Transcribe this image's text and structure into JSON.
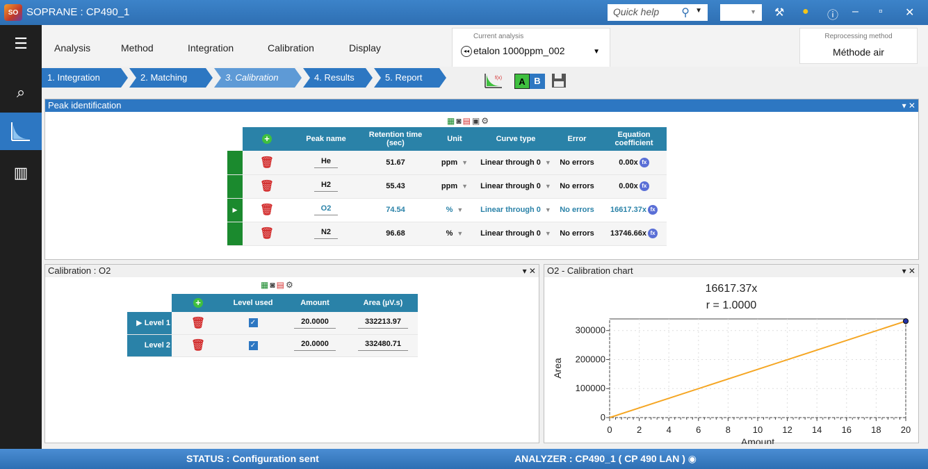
{
  "window": {
    "title": "SOPRANE : CP490_1",
    "logo_text": "SO",
    "quick_help_placeholder": "Quick help"
  },
  "menu": {
    "items": [
      "Analysis",
      "Method",
      "Integration",
      "Calibration",
      "Display"
    ]
  },
  "current_analysis": {
    "label": "Current analysis",
    "value": "etalon 1000ppm_002"
  },
  "reprocessing": {
    "label": "Reprocessing method",
    "value": "Méthode air"
  },
  "steps": [
    "1. Integration",
    "2. Matching",
    "3. Calibration",
    "4. Results",
    "5. Report"
  ],
  "active_step": "3. Calibration",
  "ab_toggle": {
    "a": "A",
    "b": "B"
  },
  "peak_panel": {
    "title": "Peak identification",
    "columns": [
      "Peak name",
      "Retention time (sec)",
      "Unit",
      "Curve type",
      "Error",
      "Equation coefficient"
    ],
    "rows": [
      {
        "name": "He",
        "rt": "51.67",
        "unit": "ppm",
        "curve": "Linear through 0",
        "error": "No errors",
        "coef": "0.00x"
      },
      {
        "name": "H2",
        "rt": "55.43",
        "unit": "ppm",
        "curve": "Linear through 0",
        "error": "No errors",
        "coef": "0.00x"
      },
      {
        "name": "O2",
        "rt": "74.54",
        "unit": "%",
        "curve": "Linear through 0",
        "error": "No errors",
        "coef": "16617.37x"
      },
      {
        "name": "N2",
        "rt": "96.68",
        "unit": "%",
        "curve": "Linear through 0",
        "error": "No errors",
        "coef": "13746.66x"
      }
    ],
    "selected_row": 2
  },
  "calibration_panel": {
    "title": "Calibration : O2",
    "columns": [
      "Level used",
      "Amount",
      "Area  (µV.s)"
    ],
    "rows": [
      {
        "level": "Level 1",
        "used": true,
        "amount": "20.0000",
        "area": "332213.97"
      },
      {
        "level": "Level 2",
        "used": true,
        "amount": "20.0000",
        "area": "332480.71"
      }
    ]
  },
  "chart_panel": {
    "title": "O2 - Calibration chart",
    "equation": "16617.37x",
    "r": "r = 1.0000"
  },
  "chart_data": {
    "type": "line",
    "title": "16617.37x",
    "subtitle": "r = 1.0000",
    "xlabel": "Amount",
    "ylabel": "Area",
    "xlim": [
      0,
      20
    ],
    "ylim": [
      0,
      340000
    ],
    "x_ticks": [
      "0",
      "2",
      "4",
      "6",
      "8",
      "10",
      "12",
      "14",
      "16",
      "18",
      "20"
    ],
    "y_ticks": [
      "0",
      "100000",
      "200000",
      "300000"
    ],
    "series": [
      {
        "x": [
          0,
          20
        ],
        "y": [
          0,
          332347.4
        ],
        "color": "#f5a623"
      }
    ],
    "points": [
      {
        "x": 20,
        "y": 332213.97
      },
      {
        "x": 20,
        "y": 332480.71
      }
    ],
    "grid": true
  },
  "status": {
    "status_text": "STATUS :  Configuration sent",
    "analyzer_text": "ANALYZER :  CP490_1 ( CP 490 LAN )"
  },
  "colors": {
    "accent": "#2d77c2",
    "table_header": "#2a82a8",
    "row_marker": "#1b8a2e",
    "line": "#f5a623"
  }
}
